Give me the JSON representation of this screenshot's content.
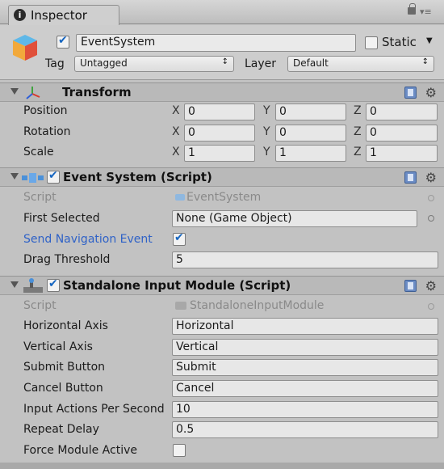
{
  "window": {
    "tab_title": "Inspector",
    "menu_glyph": "▾≡"
  },
  "header": {
    "object_name": "EventSystem",
    "active": true,
    "static_label": "Static",
    "static_checked": false,
    "tag_label": "Tag",
    "tag_value": "Untagged",
    "layer_label": "Layer",
    "layer_value": "Default"
  },
  "transform": {
    "title": "Transform",
    "rows": [
      {
        "label": "Position",
        "x": "0",
        "y": "0",
        "z": "0"
      },
      {
        "label": "Rotation",
        "x": "0",
        "y": "0",
        "z": "0"
      },
      {
        "label": "Scale",
        "x": "1",
        "y": "1",
        "z": "1"
      }
    ],
    "axis_labels": {
      "x": "X",
      "y": "Y",
      "z": "Z"
    }
  },
  "event_system": {
    "title": "Event System (Script)",
    "enabled": true,
    "script_label": "Script",
    "script_value": "EventSystem",
    "first_selected_label": "First Selected",
    "first_selected_value": "None (Game Object)",
    "send_nav_label": "Send Navigation Event",
    "send_nav_checked": true,
    "drag_threshold_label": "Drag Threshold",
    "drag_threshold_value": "5"
  },
  "input_module": {
    "title": "Standalone Input Module (Script)",
    "enabled": true,
    "script_label": "Script",
    "script_value": "StandaloneInputModule",
    "fields": [
      {
        "label": "Horizontal Axis",
        "value": "Horizontal"
      },
      {
        "label": "Vertical Axis",
        "value": "Vertical"
      },
      {
        "label": "Submit Button",
        "value": "Submit"
      },
      {
        "label": "Cancel Button",
        "value": "Cancel"
      },
      {
        "label": "Input Actions Per Second",
        "value": "10"
      },
      {
        "label": "Repeat Delay",
        "value": "0.5"
      }
    ],
    "force_label": "Force Module Active",
    "force_checked": false
  },
  "colors": {
    "accent": "#2f62c7",
    "check": "#1565c0",
    "panel": "#c2c2c2"
  }
}
